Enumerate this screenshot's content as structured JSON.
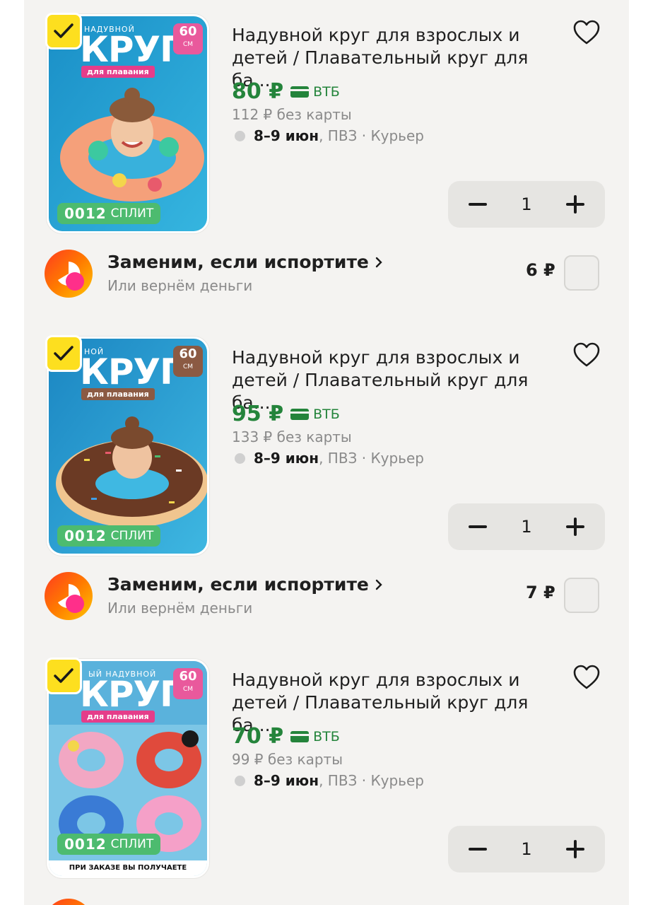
{
  "currency": "₽",
  "card_label": "ВТБ",
  "products": [
    {
      "thumb": {
        "pre": "НАДУВНОЙ",
        "title": "КРУГ",
        "sub": "для плавания",
        "size_num": "60",
        "size_unit": "СМ",
        "split_digits": "0012",
        "split_word": "СПЛИТ",
        "bottom_note": ""
      },
      "title": "Надувной круг для взрослых и детей / Плавательный круг для ба...",
      "price": "80 ₽",
      "old_price": "112 ₽  без карты",
      "delivery_date": "8–9 июн",
      "delivery_rest": ", ПВЗ · Курьер",
      "qty": "1",
      "service": {
        "title": "Заменим, если испортите",
        "subtitle": "Или вернём деньги",
        "price": "6 ₽"
      }
    },
    {
      "thumb": {
        "pre": "НОЙ",
        "title": "КРУГ",
        "sub": "для плавания",
        "size_num": "60",
        "size_unit": "СМ",
        "split_digits": "0012",
        "split_word": "СПЛИТ",
        "bottom_note": ""
      },
      "title": "Надувной круг для взрослых и детей / Плавательный круг для ба...",
      "price": "95 ₽",
      "old_price": "133 ₽  без карты",
      "delivery_date": "8–9 июн",
      "delivery_rest": ", ПВЗ · Курьер",
      "qty": "1",
      "service": {
        "title": "Заменим, если испортите",
        "subtitle": "Или вернём деньги",
        "price": "7 ₽"
      }
    },
    {
      "thumb": {
        "pre": "ЫЙ НАДУВНОЙ",
        "title": "КРУГ",
        "sub": "для плавания",
        "size_num": "60",
        "size_unit": "СМ",
        "split_digits": "0012",
        "split_word": "СПЛИТ",
        "bottom_note": "ПРИ ЗАКАЗЕ ВЫ ПОЛУЧАЕТЕ СЛУЧАЙНЫЙ ЦВЕТ"
      },
      "title": "Надувной круг для взрослых и детей / Плавательный круг для ба...",
      "price": "70 ₽",
      "old_price": "99 ₽  без карты",
      "delivery_date": "8–9 июн",
      "delivery_rest": ", ПВЗ · Курьер",
      "qty": "1"
    }
  ],
  "colors": {
    "accent_green": "#24843b",
    "check_yellow": "#fddf1f",
    "split_green": "#4dbb6f",
    "panel_bg": "#f4f3f1",
    "stepper_bg": "#e6e5e2"
  },
  "icons": {
    "favorite": "heart-outline-icon",
    "check": "checkmark-icon",
    "minus": "minus-icon",
    "plus": "plus-icon",
    "chevron": "chevron-right-icon",
    "card": "bank-card-icon",
    "service_logo": "service-logo-icon"
  }
}
